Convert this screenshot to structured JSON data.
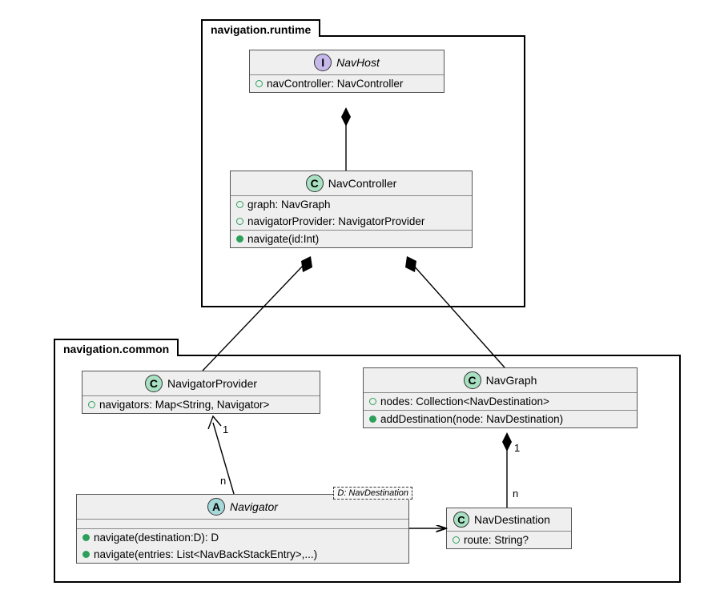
{
  "packages": {
    "runtime": {
      "name": "navigation.runtime"
    },
    "common": {
      "name": "navigation.common"
    }
  },
  "classes": {
    "navhost": {
      "badge": "I",
      "name": "NavHost",
      "attrs": [
        "navController: NavController"
      ]
    },
    "navcontroller": {
      "badge": "C",
      "name": "NavController",
      "attrs": [
        "graph: NavGraph",
        "navigatorProvider: NavigatorProvider"
      ],
      "ops": [
        "navigate(id:Int)"
      ]
    },
    "navigatorprovider": {
      "badge": "C",
      "name": "NavigatorProvider",
      "attrs": [
        "navigators: Map<String, Navigator>"
      ]
    },
    "navgraph": {
      "badge": "C",
      "name": "NavGraph",
      "attrs": [
        "nodes: Collection<NavDestination>"
      ],
      "ops": [
        "addDestination(node: NavDestination)"
      ]
    },
    "navigator": {
      "badge": "A",
      "name": "Navigator",
      "template": "D: NavDestination",
      "ops": [
        "navigate(destination:D): D",
        "navigate(entries: List<NavBackStackEntry>,...)"
      ]
    },
    "navdestination": {
      "badge": "C",
      "name": "NavDestination",
      "attrs": [
        "route: String?"
      ]
    }
  },
  "relationships": {
    "navhost_navcontroller": {
      "type": "composition"
    },
    "navcontroller_navigatorprovider": {
      "type": "composition"
    },
    "navcontroller_navgraph": {
      "type": "composition"
    },
    "navigatorprovider_navigator": {
      "type": "association",
      "end1": "1",
      "end2": "n"
    },
    "navgraph_navdestination": {
      "type": "composition",
      "end1": "1",
      "end2": "n"
    },
    "navigator_navdestination": {
      "type": "association"
    }
  }
}
